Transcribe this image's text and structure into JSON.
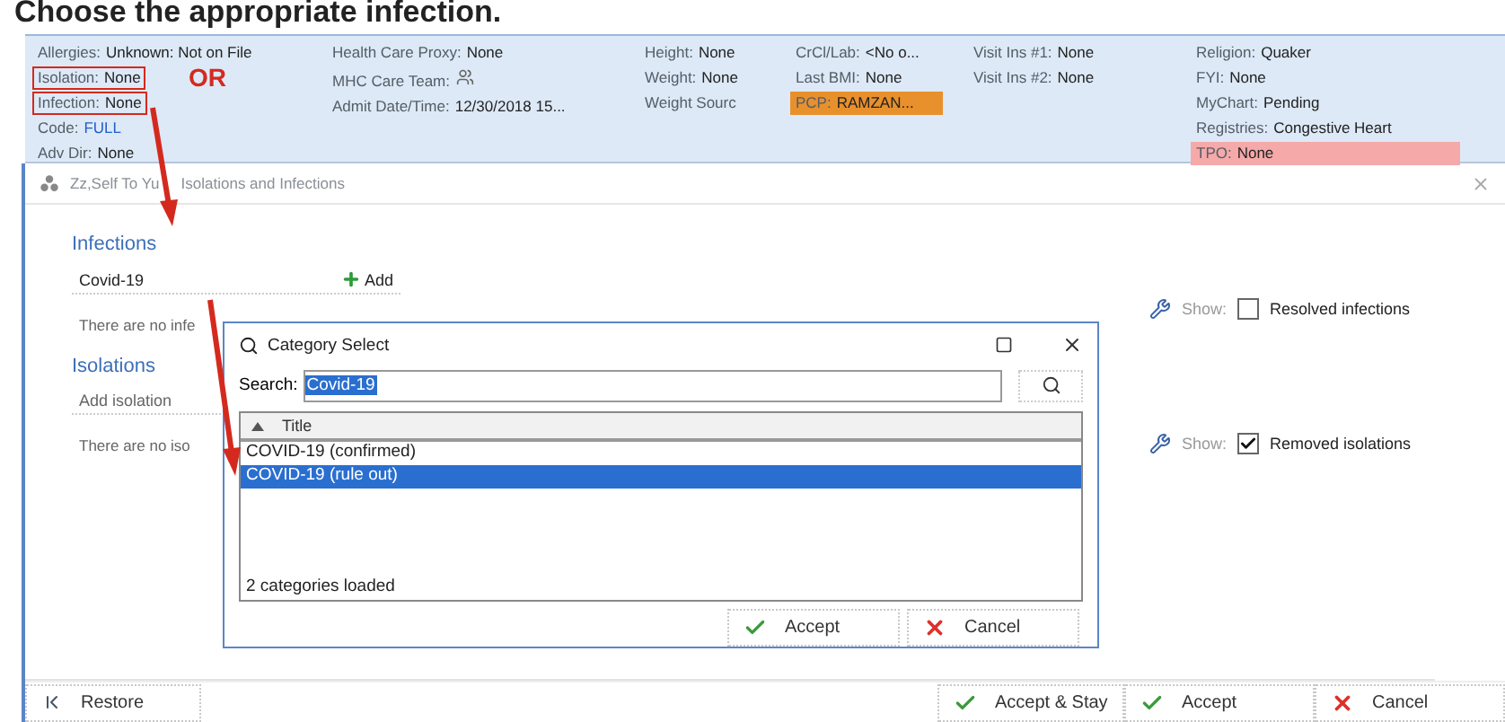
{
  "caption": "Choose the appropriate infection.",
  "header": {
    "columns": [
      [
        {
          "label": "Allergies:",
          "value": "Unknown: Not on File",
          "boxed": false,
          "emphasis": false
        },
        {
          "label": "Isolation:",
          "value": "None",
          "boxed": true,
          "emphasis": false
        },
        {
          "label": "Infection:",
          "value": "None",
          "boxed": true,
          "emphasis": false
        },
        {
          "label": "Code:",
          "value": "FULL",
          "boxed": false,
          "emphasis": true
        },
        {
          "label": "Adv Dir:",
          "value": "None",
          "boxed": false,
          "emphasis": false
        }
      ],
      [
        {
          "label": "Health Care Proxy:",
          "value": "None"
        },
        {
          "label": "MHC Care Team:",
          "kind": "icon"
        },
        {
          "label": "Admit Date/Time:",
          "value": "12/30/2018 15..."
        }
      ],
      [
        {
          "label": "Height:",
          "value": "None"
        },
        {
          "label": "Weight:",
          "value": "None"
        },
        {
          "label": "Weight Sourc"
        }
      ],
      [
        {
          "label": "CrCl/Lab:",
          "value": "<No o..."
        },
        {
          "label": "Last BMI:",
          "value": "None"
        },
        {
          "label": "PCP:",
          "value": "RAMZAN...",
          "color": "#e8902c"
        }
      ],
      [
        {
          "label": "Visit Ins #1:",
          "value": "None"
        },
        {
          "label": "Visit Ins #2:",
          "value": "None"
        }
      ],
      [
        {
          "label": "Religion:",
          "value": "Quaker"
        },
        {
          "label": "FYI:",
          "value": "None"
        },
        {
          "label": "MyChart:",
          "value": "Pending"
        },
        {
          "label": "Registries:",
          "value": "Congestive Heart"
        },
        {
          "label": "TPO:",
          "value": "None",
          "color": "#f5a9a9"
        }
      ]
    ]
  },
  "annotation": {
    "note": "OR"
  },
  "window": {
    "title_parts": [
      "Zz,Self To Yu",
      "Isolations and Infections"
    ]
  },
  "infections": {
    "heading": "Infections",
    "input_value": "Covid-19",
    "add_label": "Add",
    "empty_text": "There are no infe",
    "show_label": "Show:",
    "filter_label": "Resolved infections",
    "filter_checked": false
  },
  "isolations": {
    "heading": "Isolations",
    "input_placeholder": "Add isolation",
    "empty_text": "There are no iso",
    "show_label": "Show:",
    "filter_label": "Removed isolations",
    "filter_checked": true
  },
  "dialog": {
    "title": "Category Select",
    "search_label": "Search:",
    "search_value": "Covid-19",
    "search_selected": true,
    "column": "Title",
    "rows": [
      {
        "label": "COVID-19 (confirmed)",
        "selected": false
      },
      {
        "label": "COVID-19 (rule out)",
        "selected": true
      }
    ],
    "status": "2 categories loaded",
    "buttons": [
      {
        "label": "Accept",
        "kind": "accept"
      },
      {
        "label": "Cancel",
        "kind": "cancel"
      }
    ]
  },
  "footer": {
    "restore_label": "Restore",
    "buttons": [
      {
        "label": "Accept & Stay",
        "kind": "accept"
      },
      {
        "label": "Accept",
        "kind": "accept"
      },
      {
        "label": "Cancel",
        "kind": "cancel"
      }
    ]
  }
}
